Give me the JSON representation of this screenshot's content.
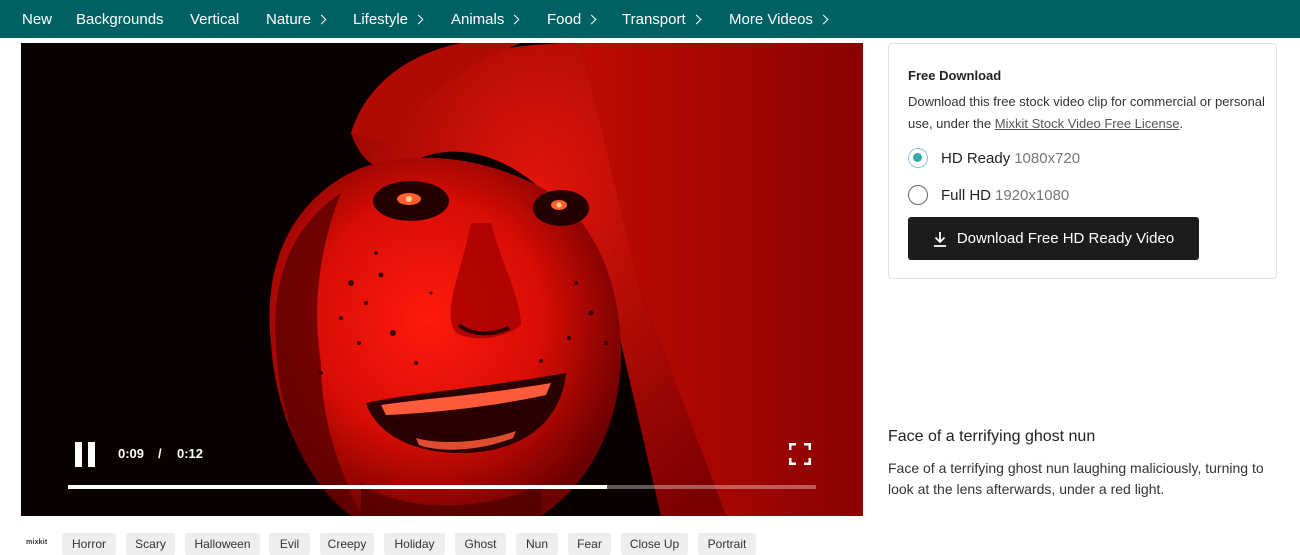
{
  "nav": {
    "items": [
      {
        "label": "New"
      },
      {
        "label": "Backgrounds"
      },
      {
        "label": "Vertical"
      },
      {
        "label": "Nature"
      },
      {
        "label": "Lifestyle"
      },
      {
        "label": "Animals"
      },
      {
        "label": "Food"
      },
      {
        "label": "Transport"
      },
      {
        "label": "More Videos"
      }
    ]
  },
  "player": {
    "current_time": "0:09",
    "separator": "/",
    "duration": "0:12",
    "progress_fraction": 0.72,
    "state": "playing",
    "pause_icon": "pause-icon",
    "fullscreen_icon": "fullscreen-icon"
  },
  "download": {
    "heading": "Free Download",
    "desc_prefix": "Download this free stock video clip for commercial or personal use, under the",
    "license_link": "Mixkit Stock Video Free License",
    "desc_suffix": ".",
    "options": [
      {
        "label": "HD Ready",
        "resolution": "1080x720",
        "selected": true
      },
      {
        "label": "Full HD",
        "resolution": "1920x1080",
        "selected": false
      }
    ],
    "button_label": "Download Free HD Ready Video",
    "button_icon": "download-icon"
  },
  "video_info": {
    "title": "Face of a terrifying ghost nun",
    "description": "Face of a terrifying ghost nun laughing maliciously, turning to look at the lens afterwards, under a red light."
  },
  "tags": {
    "logo": "mixkit",
    "items": [
      "Horror",
      "Scary",
      "Halloween",
      "Evil",
      "Creepy",
      "Holiday",
      "Ghost",
      "Nun",
      "Fear",
      "Close Up",
      "Portrait"
    ]
  },
  "colors": {
    "nav_bg": "#006064",
    "accent": "#3aa7ab",
    "button_bg": "#1c1c1c",
    "tag_bg": "#eeeeee"
  }
}
